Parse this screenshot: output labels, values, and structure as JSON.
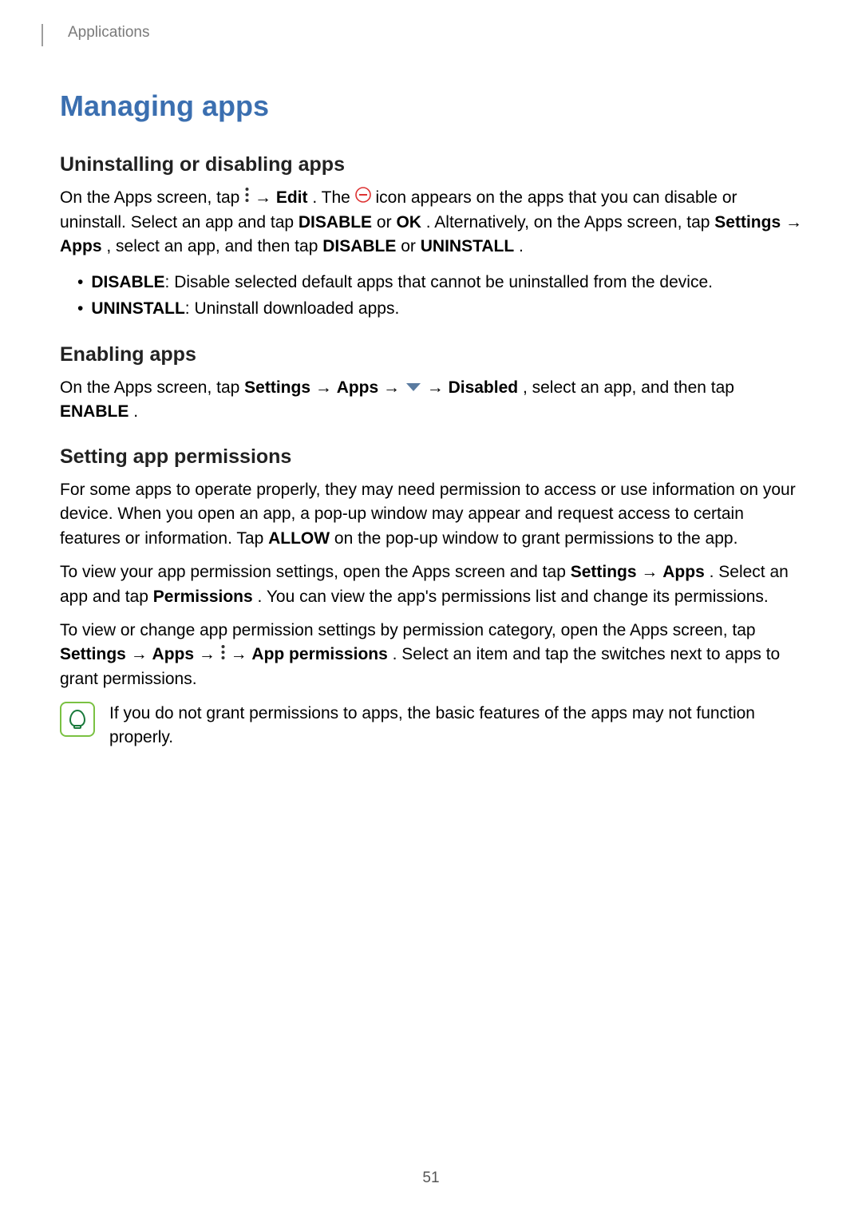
{
  "header": {
    "section_label": "Applications"
  },
  "title": "Managing apps",
  "s1": {
    "heading": "Uninstalling or disabling apps",
    "p1a": "On the Apps screen, tap ",
    "p1b": " → ",
    "edit": "Edit",
    "p1c": ". The ",
    "p1d": " icon appears on the apps that you can disable or uninstall. Select an app and tap ",
    "disable": "DISABLE",
    "or1": " or ",
    "ok": "OK",
    "p1e": ". Alternatively, on the Apps screen, tap ",
    "settings": "Settings",
    "arrow": " → ",
    "apps": "Apps",
    "p1f": ", select an app, and then tap ",
    "or2": " or ",
    "uninstall": "UNINSTALL",
    "period": ".",
    "bullets": [
      {
        "b": "DISABLE",
        "t": ": Disable selected default apps that cannot be uninstalled from the device."
      },
      {
        "b": "UNINSTALL",
        "t": ": Uninstall downloaded apps."
      }
    ]
  },
  "s2": {
    "heading": "Enabling apps",
    "p1a": "On the Apps screen, tap ",
    "settings": "Settings",
    "arrow": " → ",
    "apps": "Apps",
    "arrow2": " → ",
    "arrow3": " → ",
    "disabled": "Disabled",
    "p1b": ", select an app, and then tap ",
    "enable": "ENABLE",
    "period": "."
  },
  "s3": {
    "heading": "Setting app permissions",
    "p1": "For some apps to operate properly, they may need permission to access or use information on your device. When you open an app, a pop-up window may appear and request access to certain features or information. Tap ",
    "allow": "ALLOW",
    "p1b": " on the pop-up window to grant permissions to the app.",
    "p2a": "To view your app permission settings, open the Apps screen and tap ",
    "settings": "Settings",
    "arrow": " → ",
    "apps": "Apps",
    "p2b": ". Select an app and tap ",
    "permissions": "Permissions",
    "p2c": ". You can view the app's permissions list and change its permissions.",
    "p3a": "To view or change app permission settings by permission category, open the Apps screen, tap ",
    "arrow2": " → ",
    "arrow3": " → ",
    "app_permissions": "App permissions",
    "p3b": ". Select an item and tap the switches next to apps to grant permissions."
  },
  "note": {
    "text": "If you do not grant permissions to apps, the basic features of the apps may not function properly."
  },
  "page_number": "51"
}
